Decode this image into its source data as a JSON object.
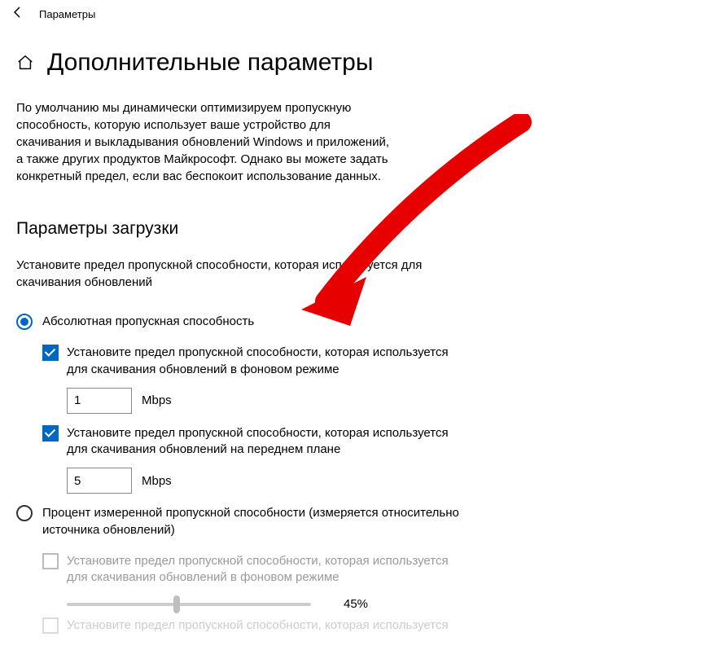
{
  "titlebar": {
    "label": "Параметры"
  },
  "page": {
    "title": "Дополнительные параметры"
  },
  "intro": "По умолчанию мы динамически оптимизируем пропускную способность, которую использует ваше устройство для скачивания и выкладывания обновлений Windows и приложений, а также других продуктов Майкрософт. Однако вы можете задать конкретный предел, если вас беспокоит использование данных.",
  "section": {
    "title": "Параметры загрузки",
    "desc": "Установите предел пропускной способности, которая используется для скачивания обновлений"
  },
  "radios": {
    "absolute": "Абсолютная пропускная способность",
    "percent": "Процент измеренной пропускной способности (измеряется относительно источника обновлений)"
  },
  "checks": {
    "bg": "Установите предел пропускной способности, которая используется для скачивания обновлений в фоновом режиме",
    "fg": "Установите предел пропускной способности, которая используется для скачивания обновлений на переднем плане",
    "pct_bg": "Установите предел пропускной способности, которая используется для скачивания обновлений в фоновом режиме",
    "pct_fg": "Установите предел пропускной способности, которая используется"
  },
  "inputs": {
    "bg_value": "1",
    "fg_value": "5",
    "unit": "Mbps"
  },
  "slider": {
    "value": "45%"
  }
}
